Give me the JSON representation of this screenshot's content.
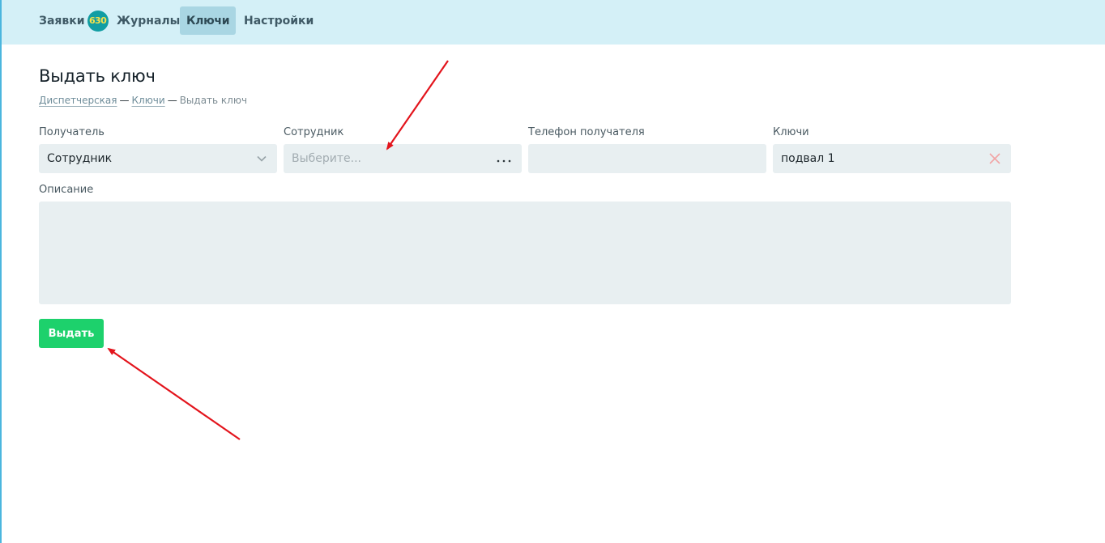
{
  "nav": {
    "requests_label": "Заявки",
    "requests_count": "630",
    "journals_label": "Журналы",
    "keys_label": "Ключи",
    "settings_label": "Настройки",
    "active": "keys"
  },
  "page": {
    "title": "Выдать ключ"
  },
  "breadcrumb": {
    "items": [
      "Диспетчерская",
      "Ключи",
      "Выдать ключ"
    ],
    "separator": "—"
  },
  "form": {
    "recipient": {
      "label": "Получатель",
      "value": "Сотрудник"
    },
    "employee": {
      "label": "Сотрудник",
      "placeholder": "Выберите...",
      "more": "..."
    },
    "phone": {
      "label": "Телефон получателя",
      "value": ""
    },
    "keys": {
      "label": "Ключи",
      "value": "подвал 1"
    },
    "description": {
      "label": "Описание",
      "value": ""
    },
    "submit_label": "Выдать"
  },
  "colors": {
    "nav_bg": "#d4f0f7",
    "active_tab": "#a9d6e3",
    "badge": "#119da3",
    "badge_text": "#f7e14a",
    "field_bg": "#e8eff1",
    "submit": "#1dd16c",
    "clear_icon": "#f2a4a4",
    "annotation_arrow": "#e3141c"
  },
  "icons": {
    "recipient_dropdown": "chevron-down-icon",
    "employee_more": "ellipsis-icon",
    "keys_clear": "close-icon"
  }
}
